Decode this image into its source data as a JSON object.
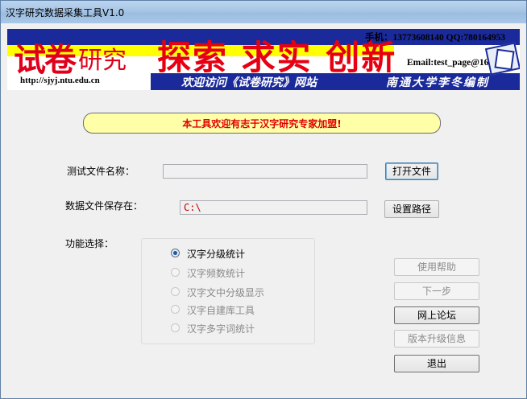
{
  "window": {
    "title": "汉字研究数据采集工具V1.0"
  },
  "banner": {
    "logo_mark": "试卷",
    "logo_text": "研究",
    "slogan": "探索 求实 创新",
    "phone": "手机：13773608140  QQ:780164953",
    "email": "Email:test_page@163.com",
    "url": "http://sjyj.ntu.edu.cn",
    "welcome": "欢迎访问《试卷研究》网站",
    "author": "南通大学李冬编制",
    "colors": {
      "red": "#e60012",
      "navy": "#1a2a9a",
      "yellow": "#ffff00"
    }
  },
  "notice": {
    "text": "本工具欢迎有志于汉字研究专家加盟!"
  },
  "form": {
    "test_file_label": "测试文件名称：",
    "test_file_value": "",
    "open_file_button": "打开文件",
    "save_path_label": "数据文件保存在：",
    "save_path_value": "C:\\",
    "set_path_button": "设置路径",
    "function_label": "功能选择："
  },
  "functions": [
    {
      "label": "汉字分级统计",
      "selected": true,
      "enabled": true
    },
    {
      "label": "汉字频数统计",
      "selected": false,
      "enabled": false
    },
    {
      "label": "汉字文中分级显示",
      "selected": false,
      "enabled": false
    },
    {
      "label": "汉字自建库工具",
      "selected": false,
      "enabled": false
    },
    {
      "label": "汉字多字词统计",
      "selected": false,
      "enabled": false
    }
  ],
  "side_buttons": {
    "help": "使用帮助",
    "next": "下一步",
    "forum": "网上论坛",
    "upgrade": "版本升级信息",
    "exit": "退出"
  }
}
